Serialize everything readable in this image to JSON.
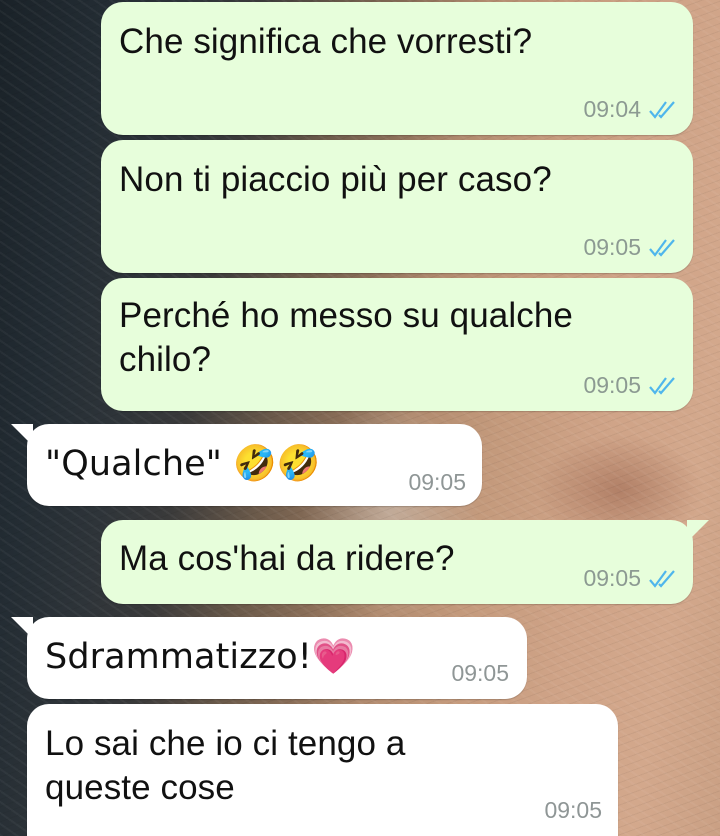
{
  "chat": {
    "messages": [
      {
        "direction": "outgoing",
        "text": "Che significa che vorresti?",
        "time": "09:04",
        "status_icon": "double-check-read-icon"
      },
      {
        "direction": "outgoing",
        "text": "Non ti piaccio più per caso?",
        "time": "09:05",
        "status_icon": "double-check-read-icon"
      },
      {
        "direction": "outgoing",
        "text": "Perché ho messo su qualche\nchilo?",
        "time": "09:05",
        "status_icon": "double-check-read-icon"
      },
      {
        "direction": "incoming",
        "text": "\"Qualche\" 🤣🤣",
        "time": "09:05"
      },
      {
        "direction": "outgoing",
        "text": "Ma cos'hai da ridere?",
        "time": "09:05",
        "status_icon": "double-check-read-icon"
      },
      {
        "direction": "incoming",
        "text": "Sdrammatizzo!💗",
        "time": "09:05"
      },
      {
        "direction": "incoming",
        "text": "Lo sai che io ci tengo a\nqueste cose",
        "time": "09:05"
      }
    ]
  },
  "colors": {
    "outgoing_bubble": "#e7fedb",
    "incoming_bubble": "#ffffff",
    "read_ticks": "#4fb6ec",
    "timestamp": "#8c9a92"
  }
}
